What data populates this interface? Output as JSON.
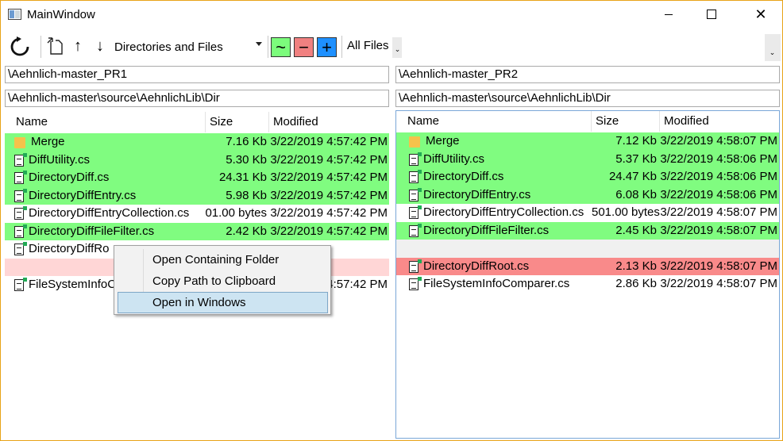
{
  "window": {
    "title": "MainWindow",
    "close_glyph": "✕"
  },
  "toolbar": {
    "mode_value": "Directories and Files",
    "equal_label": "~",
    "minus_label": "−",
    "plus_label": "+",
    "filter_value": "All Files",
    "up_glyph": "↑",
    "down_glyph": "↓",
    "dropdown_glyph": "⌄",
    "colors": {
      "equal": "#7cfc7c",
      "minus": "#f08080",
      "plus": "#1e90ff"
    }
  },
  "left": {
    "path1": "\\Aehnlich-master_PR1",
    "path2": "\\Aehnlich-master\\source\\AehnlichLib\\Dir",
    "columns": [
      "Name",
      "Size",
      "Modified"
    ],
    "rows": [
      {
        "name": "Merge",
        "size": "7.16 Kb",
        "modified": "3/22/2019 4:57:42 PM",
        "state": "green",
        "icon": "folder"
      },
      {
        "name": "DiffUtility.cs",
        "size": "5.30 Kb",
        "modified": "3/22/2019 4:57:42 PM",
        "state": "green",
        "icon": "file"
      },
      {
        "name": "DirectoryDiff.cs",
        "size": "24.31 Kb",
        "modified": "3/22/2019 4:57:42 PM",
        "state": "green",
        "icon": "file"
      },
      {
        "name": "DirectoryDiffEntry.cs",
        "size": "5.98 Kb",
        "modified": "3/22/2019 4:57:42 PM",
        "state": "green",
        "icon": "file"
      },
      {
        "name": "DirectoryDiffEntryCollection.cs",
        "size": "01.00 bytes",
        "modified": "3/22/2019 4:57:42 PM",
        "state": "white",
        "icon": "file"
      },
      {
        "name": "DirectoryDiffFileFilter.cs",
        "size": "2.42 Kb",
        "modified": "3/22/2019 4:57:42 PM",
        "state": "green",
        "icon": "file"
      },
      {
        "name": "DirectoryDiffRo",
        "size": "",
        "modified": "",
        "state": "white",
        "icon": "file"
      },
      {
        "name": "",
        "size": "",
        "modified": "",
        "state": "pink",
        "icon": "none"
      },
      {
        "name": "FileSystemInfoC",
        "size": "",
        "modified": "4:57:42 PM",
        "state": "white",
        "icon": "file"
      }
    ]
  },
  "right": {
    "path1": "\\Aehnlich-master_PR2",
    "path2": "\\Aehnlich-master\\source\\AehnlichLib\\Dir",
    "columns": [
      "Name",
      "Size",
      "Modified"
    ],
    "rows": [
      {
        "name": "Merge",
        "size": "7.12 Kb",
        "modified": "3/22/2019 4:58:07 PM",
        "state": "green",
        "icon": "folder"
      },
      {
        "name": "DiffUtility.cs",
        "size": "5.37 Kb",
        "modified": "3/22/2019 4:58:06 PM",
        "state": "green",
        "icon": "file"
      },
      {
        "name": "DirectoryDiff.cs",
        "size": "24.47 Kb",
        "modified": "3/22/2019 4:58:06 PM",
        "state": "green",
        "icon": "file"
      },
      {
        "name": "DirectoryDiffEntry.cs",
        "size": "6.08 Kb",
        "modified": "3/22/2019 4:58:06 PM",
        "state": "green",
        "icon": "file"
      },
      {
        "name": "DirectoryDiffEntryCollection.cs",
        "size": "501.00 bytes",
        "modified": "3/22/2019 4:58:07 PM",
        "state": "white",
        "icon": "file"
      },
      {
        "name": "DirectoryDiffFileFilter.cs",
        "size": "2.45 Kb",
        "modified": "3/22/2019 4:58:07 PM",
        "state": "green",
        "icon": "file"
      },
      {
        "name": "",
        "size": "",
        "modified": "",
        "state": "blank",
        "icon": "none"
      },
      {
        "name": "DirectoryDiffRoot.cs",
        "size": "2.13 Kb",
        "modified": "3/22/2019 4:58:07 PM",
        "state": "red",
        "icon": "file"
      },
      {
        "name": "FileSystemInfoComparer.cs",
        "size": "2.86 Kb",
        "modified": "3/22/2019 4:58:07 PM",
        "state": "white",
        "icon": "file"
      }
    ]
  },
  "context_menu": {
    "items": [
      "Open Containing Folder",
      "Copy Path to Clipboard",
      "Open in Windows"
    ],
    "selected_index": 2
  }
}
